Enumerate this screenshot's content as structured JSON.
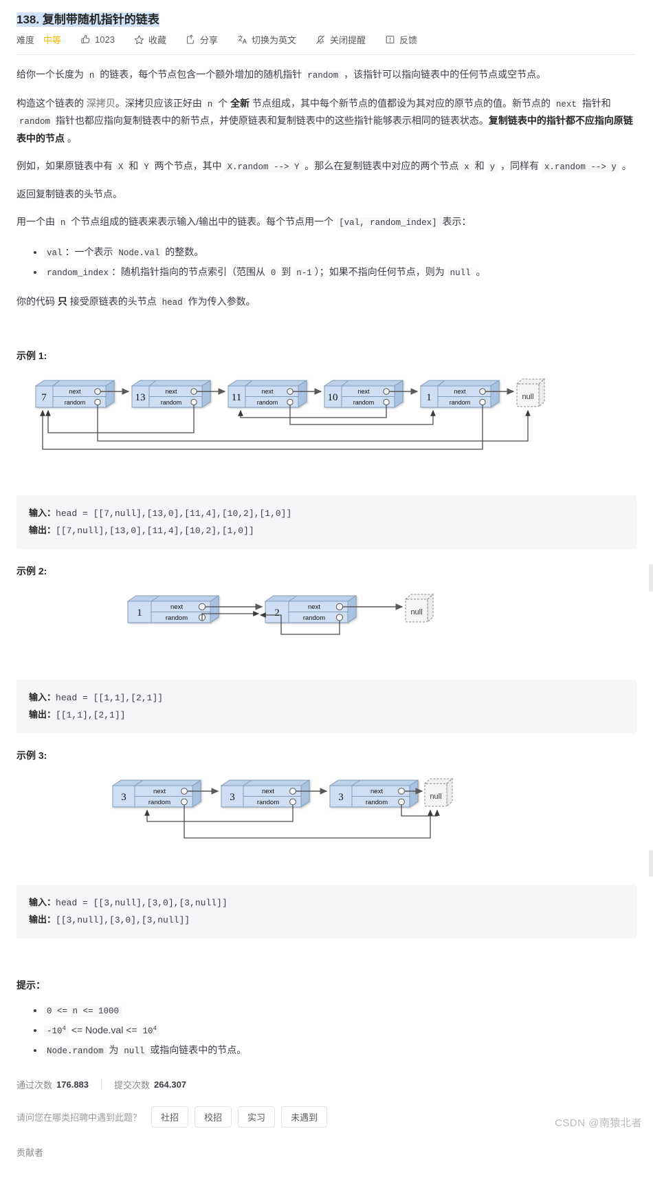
{
  "header": {
    "problem_number": "138.",
    "title": "复制带随机指针的链表",
    "full_title": "138. 复制带随机指针的链表"
  },
  "toolbar": {
    "difficulty_label": "难度",
    "difficulty_value": "中等",
    "like_count": "1023",
    "like_icon": "thumbs-up-icon",
    "favorite_label": "收藏",
    "favorite_icon": "star-icon",
    "share_label": "分享",
    "share_icon": "share-icon",
    "translate_label": "切换为英文",
    "translate_icon": "translate-icon",
    "notify_label": "关闭提醒",
    "notify_icon": "bell-off-icon",
    "feedback_label": "反馈",
    "feedback_icon": "feedback-icon"
  },
  "description": {
    "p1_a": "给你一个长度为 ",
    "p1_n": "n",
    "p1_b": " 的链表，每个节点包含一个额外增加的随机指针 ",
    "p1_random": "random",
    "p1_c": " ，该指针可以指向链表中的任何节点或空节点。",
    "p2_a": "构造这个链表的 ",
    "p2_deep": "深拷贝",
    "p2_b": "。深拷贝应该正好由 ",
    "p2_n": "n",
    "p2_c": " 个 ",
    "p2_new": "全新",
    "p2_d": " 节点组成，其中每个新节点的值都设为其对应的原节点的值。新节点的 ",
    "p2_next": "next",
    "p2_e": " 指针和 ",
    "p2_random": "random",
    "p2_f": " 指针也都应指向复制链表中的新节点，并使原链表和复制链表中的这些指针能够表示相同的链表状态。",
    "p2_bold": "复制链表中的指针都不应指向原链表中的节点 ",
    "p2_end": "。",
    "p3_a": "例如，如果原链表中有 ",
    "p3_X": "X",
    "p3_b": " 和 ",
    "p3_Y": "Y",
    "p3_c": " 两个节点，其中 ",
    "p3_XR": "X.random --> Y",
    "p3_d": " 。那么在复制链表中对应的两个节点 ",
    "p3_x": "x",
    "p3_e": " 和 ",
    "p3_y": "y",
    "p3_f": " ，同样有 ",
    "p3_xr": "x.random --> y",
    "p3_g": " 。",
    "p4": "返回复制链表的头节点。",
    "p5_a": "用一个由 ",
    "p5_n": "n",
    "p5_b": " 个节点组成的链表来表示输入/输出中的链表。每个节点用一个 ",
    "p5_code": "[val, random_index]",
    "p5_c": " 表示：",
    "bullet1_code": "val",
    "bullet1_a": "：一个表示 ",
    "bullet1_code2": "Node.val",
    "bullet1_b": " 的整数。",
    "bullet2_code": "random_index",
    "bullet2_a": "：随机指针指向的节点索引（范围从 ",
    "bullet2_code2": "0",
    "bullet2_b": " 到 ",
    "bullet2_code3": "n-1",
    "bullet2_c": "）；如果不指向任何节点，则为 ",
    "bullet2_code4": "null",
    "bullet2_d": " 。",
    "p6_a": "你的代码 ",
    "p6_only": "只",
    "p6_b": " 接受原链表的头节点 ",
    "p6_head": "head",
    "p6_c": " 作为传入参数。"
  },
  "examples": [
    {
      "heading": "示例 1:",
      "input_label": "输入：",
      "input_value": "head = [[7,null],[13,0],[11,4],[10,2],[1,0]]",
      "output_label": "输出：",
      "output_value": "[[7,null],[13,0],[11,4],[10,2],[1,0]]",
      "nodes": [
        "7",
        "13",
        "11",
        "10",
        "1"
      ],
      "null_label": "null",
      "random_targets": [
        null,
        0,
        4,
        2,
        0
      ],
      "field_next": "next",
      "field_random": "random"
    },
    {
      "heading": "示例 2:",
      "input_label": "输入：",
      "input_value": "head = [[1,1],[2,1]]",
      "output_label": "输出：",
      "output_value": "[[1,1],[2,1]]",
      "nodes": [
        "1",
        "2"
      ],
      "null_label": "null",
      "random_targets": [
        1,
        1
      ],
      "field_next": "next",
      "field_random": "random"
    },
    {
      "heading": "示例 3:",
      "input_label": "输入：",
      "input_value": "head = [[3,null],[3,0],[3,null]]",
      "output_label": "输出：",
      "output_value": "[[3,null],[3,0],[3,null]]",
      "nodes": [
        "3",
        "3",
        "3"
      ],
      "null_label": "null",
      "random_targets": [
        null,
        0,
        null
      ],
      "field_next": "next",
      "field_random": "random"
    }
  ],
  "constraints": {
    "heading": "提示：",
    "items": [
      {
        "code": "0 <= n <= 1000"
      },
      {
        "prefix_code": "-10",
        "prefix_sup": "4",
        "mid": " <= Node.val <= ",
        "suffix_code": "10",
        "suffix_sup": "4"
      },
      {
        "code": "Node.random",
        "text_a": " 为 ",
        "code2": "null",
        "text_b": " 或指向链表中的节点。"
      }
    ]
  },
  "stats": {
    "passed_label": "通过次数",
    "passed_value": "176.883",
    "submitted_label": "提交次数",
    "submitted_value": "264.307"
  },
  "poll": {
    "question": "请问您在哪类招聘中遇到此题？",
    "options": [
      "社招",
      "校招",
      "实习",
      "未遇到"
    ]
  },
  "footer": {
    "contributor_label": "贡献者"
  },
  "watermark": {
    "text": "CSDN @南猿北者"
  },
  "colors": {
    "node_fill": "#c6d9f1",
    "node_face": "#d9e5f5",
    "node_border": "#7f9db9",
    "arrow": "#595959",
    "accent_difficulty": "#ffb800",
    "title_highlight": "#cfe2f8",
    "code_bg": "#f5f6f7"
  }
}
